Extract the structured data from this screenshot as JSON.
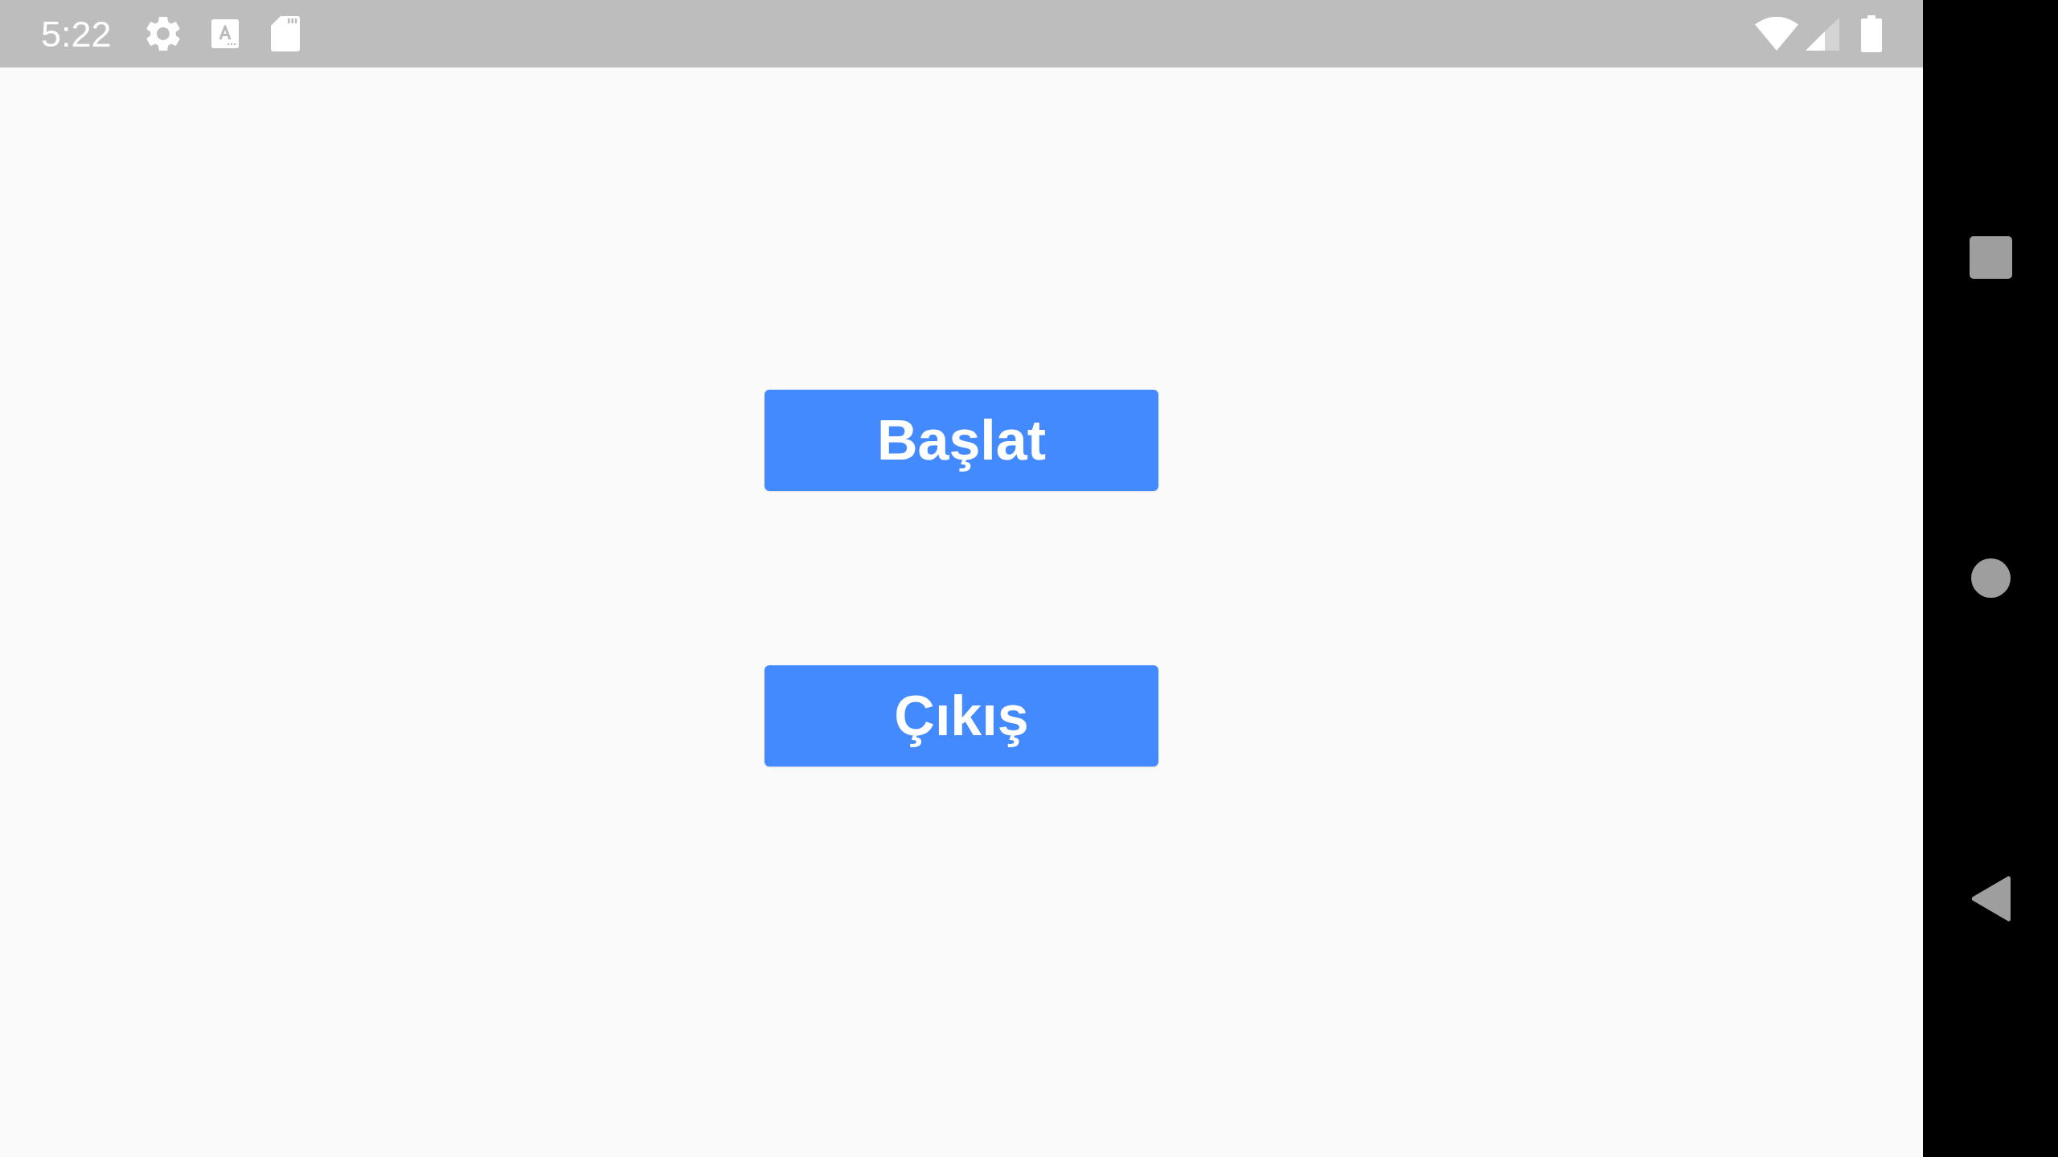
{
  "status_bar": {
    "time": "5:22"
  },
  "buttons": [
    {
      "label": "Başlat"
    },
    {
      "label": "Çıkış"
    }
  ]
}
